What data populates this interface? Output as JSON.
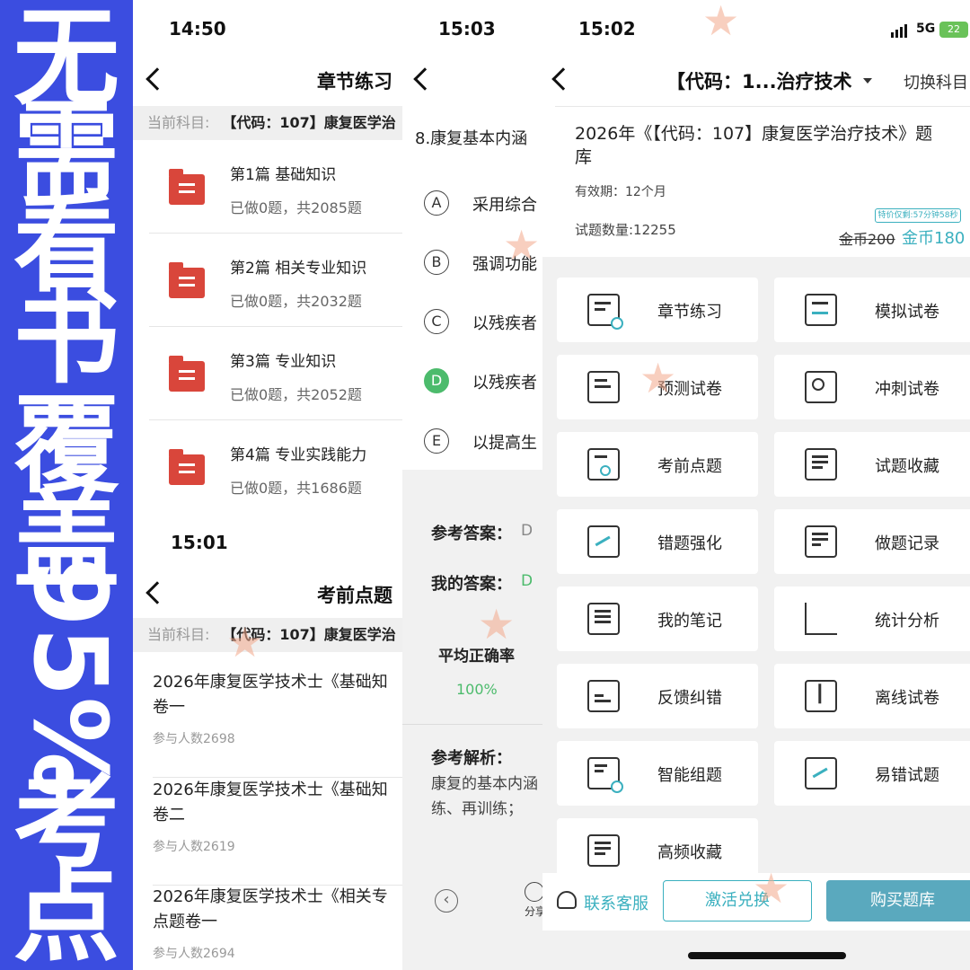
{
  "banner": {
    "line1": "无",
    "line2": "需",
    "line3": "看",
    "line4": "书",
    "line5": "覆",
    "line6": "盖",
    "pct": "95%",
    "line7": "考",
    "line8": "点"
  },
  "panel_chapter": {
    "time": "14:50",
    "title": "章节练习",
    "subject_label": "当前科目:",
    "subject_value": "【代码：107】康复医学治",
    "chapters": [
      {
        "title": "第1篇 基础知识",
        "progress": "已做0题，共2085题"
      },
      {
        "title": "第2篇 相关专业知识",
        "progress": "已做0题，共2032题"
      },
      {
        "title": "第3篇 专业知识",
        "progress": "已做0题，共2052题"
      },
      {
        "title": "第4篇 专业实践能力",
        "progress": "已做0题，共1686题"
      }
    ]
  },
  "panel_points": {
    "time": "15:01",
    "title": "考前点题",
    "subject_label": "当前科目:",
    "subject_value": "【代码：107】康复医学治",
    "papers": [
      {
        "title": "2026年康复医学技术士《基础知\n卷一",
        "people": "参与人数2698"
      },
      {
        "title": "2026年康复医学技术士《基础知\n卷二",
        "people": "参与人数2619"
      },
      {
        "title": "2026年康复医学技术士《相关专\n点题卷一",
        "people": "参与人数2694"
      }
    ]
  },
  "panel_question": {
    "time": "15:03",
    "question": "8.康复基本内涵",
    "options": [
      {
        "letter": "A",
        "text": "采用综合"
      },
      {
        "letter": "B",
        "text": "强调功能"
      },
      {
        "letter": "C",
        "text": "以残疾者"
      },
      {
        "letter": "D",
        "text": "以残疾者"
      },
      {
        "letter": "E",
        "text": "以提高生"
      }
    ],
    "selected": "D",
    "ref_answer_label": "参考答案：",
    "ref_answer": "D",
    "my_answer_label": "我的答案：",
    "my_answer": "D",
    "avg_label": "平均正确率",
    "avg_value": "100%",
    "analysis_label": "参考解析：",
    "analysis_line1": "康复的基本内涵",
    "analysis_line2": "练、再训练；",
    "share_label": "分享"
  },
  "panel_main": {
    "time": "15:02",
    "network": "5G",
    "battery": "22",
    "title": "【代码：1...治疗技术",
    "switch": "切换科目",
    "bank_title": "2026年《【代码：107】康复医学治疗技术》题库",
    "validity": "有效期：12个月",
    "question_count": "试题数量:12255",
    "promo_badge": "特价仅剩:57分钟58秒",
    "old_price": "金币200",
    "new_price": "金币180",
    "tiles": [
      {
        "label": "章节练习",
        "icon": "chapter-practice-icon"
      },
      {
        "label": "模拟试卷",
        "icon": "mock-exam-icon"
      },
      {
        "label": "预测试卷",
        "icon": "prediction-paper-icon"
      },
      {
        "label": "冲刺试卷",
        "icon": "sprint-paper-icon"
      },
      {
        "label": "考前点题",
        "icon": "pre-exam-points-icon"
      },
      {
        "label": "试题收藏",
        "icon": "bookmark-icon"
      },
      {
        "label": "错题强化",
        "icon": "wrong-reinforce-icon"
      },
      {
        "label": "做题记录",
        "icon": "record-edit-icon"
      },
      {
        "label": "我的笔记",
        "icon": "notebook-icon"
      },
      {
        "label": "统计分析",
        "icon": "bar-chart-icon"
      },
      {
        "label": "反馈纠错",
        "icon": "feedback-icon"
      },
      {
        "label": "离线试卷",
        "icon": "download-icon"
      },
      {
        "label": "智能组题",
        "icon": "smart-compose-icon"
      },
      {
        "label": "易错试题",
        "icon": "error-prone-icon"
      },
      {
        "label": "高频收藏",
        "icon": "high-frequency-icon"
      }
    ],
    "contact": "联系客服",
    "activate": "激活兑换",
    "buy": "购买题库",
    "colors": {
      "accent": "#3bb0bf",
      "buy_button": "#5aa9be",
      "price": "#3bb0bf"
    }
  }
}
